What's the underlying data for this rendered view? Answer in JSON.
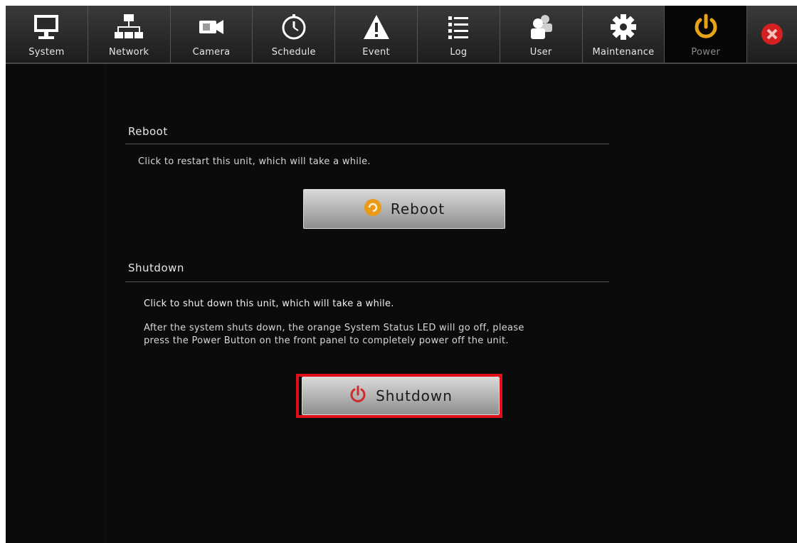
{
  "toolbar": {
    "tabs": [
      {
        "label": "System",
        "icon": "monitor-icon"
      },
      {
        "label": "Network",
        "icon": "network-icon"
      },
      {
        "label": "Camera",
        "icon": "camera-icon"
      },
      {
        "label": "Schedule",
        "icon": "clock-icon"
      },
      {
        "label": "Event",
        "icon": "warning-icon"
      },
      {
        "label": "Log",
        "icon": "list-icon"
      },
      {
        "label": "User",
        "icon": "users-icon"
      },
      {
        "label": "Maintenance",
        "icon": "gear-icon"
      },
      {
        "label": "Power",
        "icon": "power-icon",
        "active": true
      }
    ],
    "close_icon": "close-icon"
  },
  "reboot": {
    "title": "Reboot",
    "description": "Click to restart this unit, which will take a while.",
    "button_label": "Reboot",
    "button_icon": "reboot-icon"
  },
  "shutdown": {
    "title": "Shutdown",
    "description": "Click to shut down this unit, which will take a while.",
    "note_line1": "After the system shuts down, the orange System Status LED will go off, please",
    "note_line2": "press the Power Button on the front panel to completely power off the unit.",
    "button_label": "Shutdown",
    "button_icon": "power-icon"
  },
  "colors": {
    "highlight": "#e0101a",
    "power_active": "#e8a317",
    "close_red": "#d42020"
  }
}
